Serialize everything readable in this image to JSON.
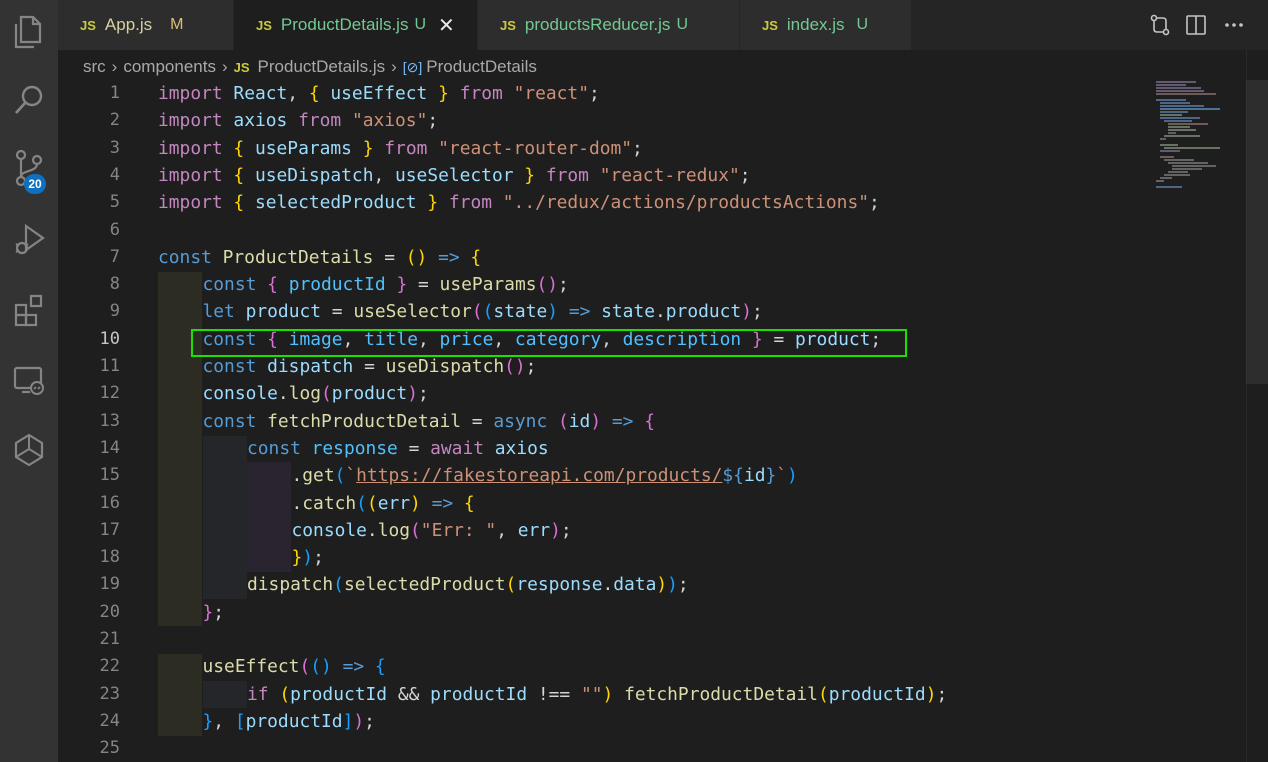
{
  "tabs": [
    {
      "icon": "JS",
      "name": "App.js",
      "status": "M",
      "active": false
    },
    {
      "icon": "JS",
      "name": "ProductDetails.js",
      "status": "U",
      "active": true
    },
    {
      "icon": "JS",
      "name": "productsReducer.js",
      "status": "U",
      "active": false
    },
    {
      "icon": "JS",
      "name": "index.js",
      "status": "U",
      "active": false
    }
  ],
  "breadcrumb": {
    "folder1": "src",
    "folder2": "components",
    "file_icon": "JS",
    "file": "ProductDetails.js",
    "symbol": "ProductDetails"
  },
  "source_control_badge": "20",
  "activity_icons": [
    "explorer-icon",
    "search-icon",
    "source-control-icon",
    "run-debug-icon",
    "extensions-icon",
    "remote-explorer-icon",
    "testing-icon"
  ],
  "colors": {
    "highlight_box": "#1ee000",
    "badge": "#0e70c0",
    "tab_js": "#cbcb41"
  },
  "lines": [
    {
      "n": "1"
    },
    {
      "n": "2"
    },
    {
      "n": "3"
    },
    {
      "n": "4"
    },
    {
      "n": "5"
    },
    {
      "n": "6"
    },
    {
      "n": "7"
    },
    {
      "n": "8"
    },
    {
      "n": "9"
    },
    {
      "n": "10"
    },
    {
      "n": "11"
    },
    {
      "n": "12"
    },
    {
      "n": "13"
    },
    {
      "n": "14"
    },
    {
      "n": "15"
    },
    {
      "n": "16"
    },
    {
      "n": "17"
    },
    {
      "n": "18"
    },
    {
      "n": "19"
    },
    {
      "n": "20"
    },
    {
      "n": "21"
    },
    {
      "n": "22"
    },
    {
      "n": "23"
    },
    {
      "n": "24"
    },
    {
      "n": "25"
    }
  ],
  "code": [
    [
      [
        "k",
        "import"
      ],
      [
        "",
        " "
      ],
      [
        "v",
        "React"
      ],
      [
        "",
        ", "
      ],
      [
        "p",
        "{"
      ],
      [
        "",
        " "
      ],
      [
        "v",
        "useEffect"
      ],
      [
        "",
        " "
      ],
      [
        "p",
        "}"
      ],
      [
        "",
        " "
      ],
      [
        "k",
        "from"
      ],
      [
        "",
        " "
      ],
      [
        "s",
        "\"react\""
      ],
      [
        "",
        ";"
      ]
    ],
    [
      [
        "k",
        "import"
      ],
      [
        "",
        " "
      ],
      [
        "v",
        "axios"
      ],
      [
        "",
        " "
      ],
      [
        "k",
        "from"
      ],
      [
        "",
        " "
      ],
      [
        "s",
        "\"axios\""
      ],
      [
        "",
        ";"
      ]
    ],
    [
      [
        "k",
        "import"
      ],
      [
        "",
        " "
      ],
      [
        "p",
        "{"
      ],
      [
        "",
        " "
      ],
      [
        "v",
        "useParams"
      ],
      [
        "",
        " "
      ],
      [
        "p",
        "}"
      ],
      [
        "",
        " "
      ],
      [
        "k",
        "from"
      ],
      [
        "",
        " "
      ],
      [
        "s",
        "\"react-router-dom\""
      ],
      [
        "",
        ";"
      ]
    ],
    [
      [
        "k",
        "import"
      ],
      [
        "",
        " "
      ],
      [
        "p",
        "{"
      ],
      [
        "",
        " "
      ],
      [
        "v",
        "useDispatch"
      ],
      [
        "",
        ", "
      ],
      [
        "v",
        "useSelector"
      ],
      [
        "",
        " "
      ],
      [
        "p",
        "}"
      ],
      [
        "",
        " "
      ],
      [
        "k",
        "from"
      ],
      [
        "",
        " "
      ],
      [
        "s",
        "\"react-redux\""
      ],
      [
        "",
        ";"
      ]
    ],
    [
      [
        "k",
        "import"
      ],
      [
        "",
        " "
      ],
      [
        "p",
        "{"
      ],
      [
        "",
        " "
      ],
      [
        "v",
        "selectedProduct"
      ],
      [
        "",
        " "
      ],
      [
        "p",
        "}"
      ],
      [
        "",
        " "
      ],
      [
        "k",
        "from"
      ],
      [
        "",
        " "
      ],
      [
        "s",
        "\"../redux/actions/productsActions\""
      ],
      [
        "",
        ";"
      ]
    ],
    [],
    [
      [
        "b",
        "const"
      ],
      [
        "",
        " "
      ],
      [
        "f",
        "ProductDetails"
      ],
      [
        "",
        " = "
      ],
      [
        "p",
        "()"
      ],
      [
        "",
        " "
      ],
      [
        "b",
        "=>"
      ],
      [
        "",
        " "
      ],
      [
        "p",
        "{"
      ]
    ],
    [
      [
        "",
        ""
      ],
      [
        "b",
        "const"
      ],
      [
        "",
        " "
      ],
      [
        "q",
        "{"
      ],
      [
        "",
        " "
      ],
      [
        "c",
        "productId"
      ],
      [
        "",
        " "
      ],
      [
        "q",
        "}"
      ],
      [
        "",
        " = "
      ],
      [
        "f",
        "useParams"
      ],
      [
        "q",
        "()"
      ],
      [
        "",
        ";"
      ]
    ],
    [
      [
        "",
        ""
      ],
      [
        "b",
        "let"
      ],
      [
        "",
        " "
      ],
      [
        "v",
        "product"
      ],
      [
        "",
        " = "
      ],
      [
        "f",
        "useSelector"
      ],
      [
        "q",
        "("
      ],
      [
        "r",
        "("
      ],
      [
        "v",
        "state"
      ],
      [
        "r",
        ")"
      ],
      [
        "",
        " "
      ],
      [
        "b",
        "=>"
      ],
      [
        "",
        " "
      ],
      [
        "v",
        "state"
      ],
      [
        "",
        "."
      ],
      [
        "v",
        "product"
      ],
      [
        "q",
        ")"
      ],
      [
        "",
        ";"
      ]
    ],
    [
      [
        "",
        ""
      ],
      [
        "b",
        "const"
      ],
      [
        "",
        " "
      ],
      [
        "q",
        "{"
      ],
      [
        "",
        " "
      ],
      [
        "c",
        "image"
      ],
      [
        "",
        ", "
      ],
      [
        "c",
        "title"
      ],
      [
        "",
        ", "
      ],
      [
        "c",
        "price"
      ],
      [
        "",
        ", "
      ],
      [
        "c",
        "category"
      ],
      [
        "",
        ", "
      ],
      [
        "c",
        "description"
      ],
      [
        "",
        " "
      ],
      [
        "q",
        "}"
      ],
      [
        "",
        " = "
      ],
      [
        "v",
        "product"
      ],
      [
        "",
        ";"
      ]
    ],
    [
      [
        "",
        ""
      ],
      [
        "b",
        "const"
      ],
      [
        "",
        " "
      ],
      [
        "v",
        "dispatch"
      ],
      [
        "",
        " = "
      ],
      [
        "f",
        "useDispatch"
      ],
      [
        "q",
        "()"
      ],
      [
        "",
        ";"
      ]
    ],
    [
      [
        "",
        ""
      ],
      [
        "v",
        "console"
      ],
      [
        "",
        "."
      ],
      [
        "f",
        "log"
      ],
      [
        "q",
        "("
      ],
      [
        "v",
        "product"
      ],
      [
        "q",
        ")"
      ],
      [
        "",
        ";"
      ]
    ],
    [
      [
        "",
        ""
      ],
      [
        "b",
        "const"
      ],
      [
        "",
        " "
      ],
      [
        "f",
        "fetchProductDetail"
      ],
      [
        "",
        " = "
      ],
      [
        "b",
        "async"
      ],
      [
        "",
        " "
      ],
      [
        "q",
        "("
      ],
      [
        "v",
        "id"
      ],
      [
        "q",
        ")"
      ],
      [
        "",
        " "
      ],
      [
        "b",
        "=>"
      ],
      [
        "",
        " "
      ],
      [
        "q",
        "{"
      ]
    ],
    [
      [
        "",
        ""
      ],
      [
        "b",
        "const"
      ],
      [
        "",
        " "
      ],
      [
        "c",
        "response"
      ],
      [
        "",
        " = "
      ],
      [
        "k",
        "await"
      ],
      [
        "",
        " "
      ],
      [
        "v",
        "axios"
      ]
    ],
    [
      [
        "",
        ""
      ],
      [
        "",
        "."
      ],
      [
        "f",
        "get"
      ],
      [
        "r",
        "("
      ],
      [
        "s",
        "`"
      ],
      [
        "url",
        "https://fakestoreapi.com/products/"
      ],
      [
        "b",
        "${"
      ],
      [
        "v",
        "id"
      ],
      [
        "b",
        "}"
      ],
      [
        "s",
        "`"
      ],
      [
        "r",
        ")"
      ]
    ],
    [
      [
        "",
        ""
      ],
      [
        "",
        "."
      ],
      [
        "f",
        "catch"
      ],
      [
        "r",
        "("
      ],
      [
        "p",
        "("
      ],
      [
        "v",
        "err"
      ],
      [
        "p",
        ")"
      ],
      [
        "",
        " "
      ],
      [
        "b",
        "=>"
      ],
      [
        "",
        " "
      ],
      [
        "p",
        "{"
      ]
    ],
    [
      [
        "",
        ""
      ],
      [
        "v",
        "console"
      ],
      [
        "",
        "."
      ],
      [
        "f",
        "log"
      ],
      [
        "q",
        "("
      ],
      [
        "s",
        "\"Err: \""
      ],
      [
        "",
        ", "
      ],
      [
        "v",
        "err"
      ],
      [
        "q",
        ")"
      ],
      [
        "",
        ";"
      ]
    ],
    [
      [
        "",
        ""
      ],
      [
        "p",
        "}"
      ],
      [
        "r",
        ")"
      ],
      [
        "",
        ";"
      ]
    ],
    [
      [
        "",
        ""
      ],
      [
        "f",
        "dispatch"
      ],
      [
        "r",
        "("
      ],
      [
        "f",
        "selectedProduct"
      ],
      [
        "p",
        "("
      ],
      [
        "v",
        "response"
      ],
      [
        "",
        "."
      ],
      [
        "v",
        "data"
      ],
      [
        "p",
        ")"
      ],
      [
        "r",
        ")"
      ],
      [
        "",
        ";"
      ]
    ],
    [
      [
        "",
        ""
      ],
      [
        "q",
        "}"
      ],
      [
        "",
        ";"
      ]
    ],
    [],
    [
      [
        "",
        ""
      ],
      [
        "f",
        "useEffect"
      ],
      [
        "q",
        "("
      ],
      [
        "r",
        "()"
      ],
      [
        "",
        " "
      ],
      [
        "b",
        "=>"
      ],
      [
        "",
        " "
      ],
      [
        "r",
        "{"
      ]
    ],
    [
      [
        "",
        ""
      ],
      [
        "k",
        "if"
      ],
      [
        "",
        " "
      ],
      [
        "p",
        "("
      ],
      [
        "v",
        "productId"
      ],
      [
        "",
        " && "
      ],
      [
        "v",
        "productId"
      ],
      [
        "",
        " !== "
      ],
      [
        "s",
        "\"\""
      ],
      [
        "p",
        ")"
      ],
      [
        "",
        " "
      ],
      [
        "f",
        "fetchProductDetail"
      ],
      [
        "p",
        "("
      ],
      [
        "v",
        "productId"
      ],
      [
        "p",
        ")"
      ],
      [
        "",
        ";"
      ]
    ],
    [
      [
        "",
        ""
      ],
      [
        "r",
        "}"
      ],
      [
        "",
        ", "
      ],
      [
        "r",
        "["
      ],
      [
        "v",
        "productId"
      ],
      [
        "r",
        "]"
      ],
      [
        "q",
        ")"
      ],
      [
        "",
        ";"
      ]
    ],
    []
  ]
}
